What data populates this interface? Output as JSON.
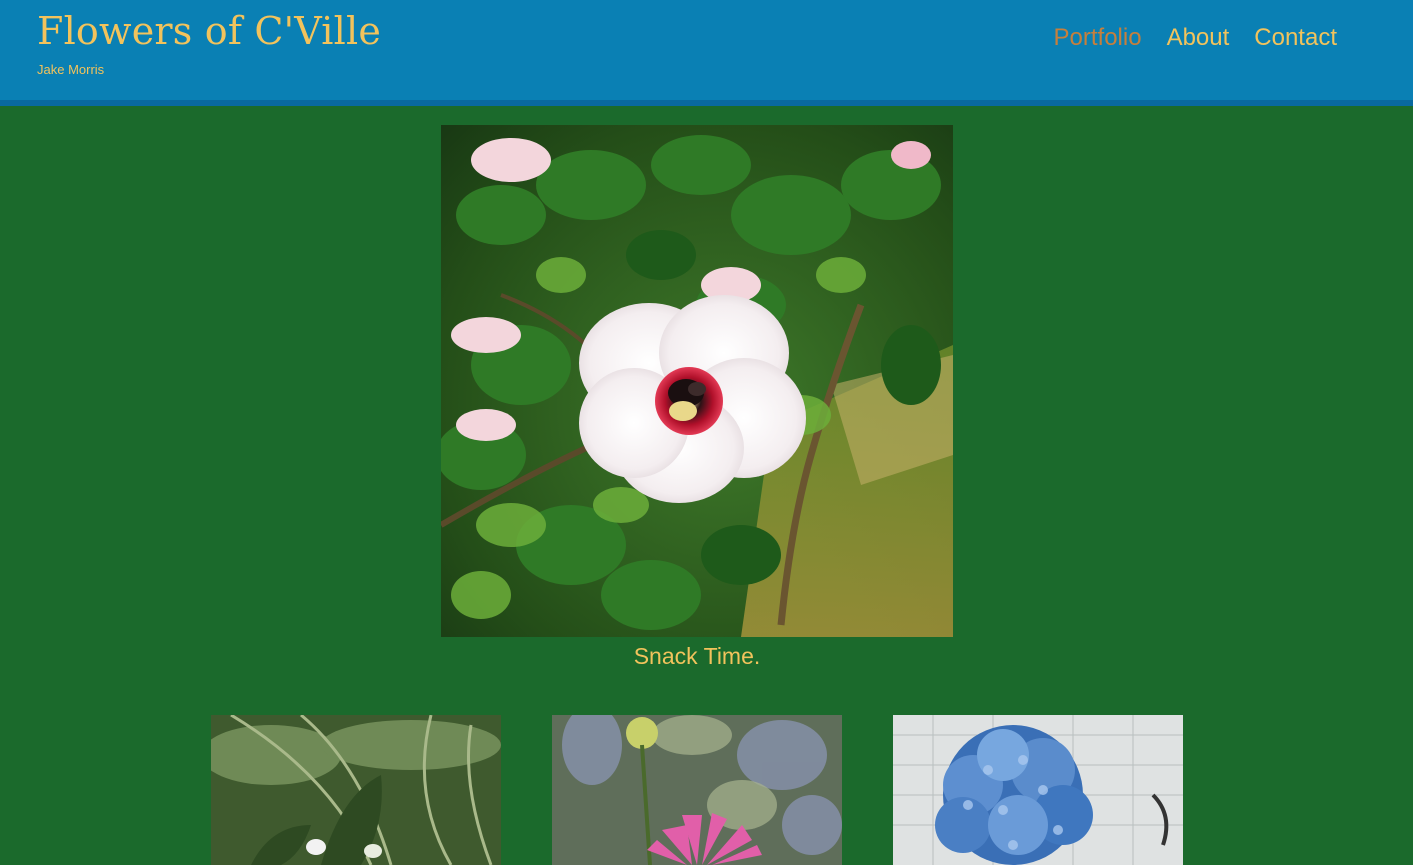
{
  "site": {
    "title": "Flowers of C'Ville",
    "subtitle": "Jake Morris"
  },
  "nav": {
    "items": [
      {
        "label": "Portfolio",
        "active": true
      },
      {
        "label": "About",
        "active": false
      },
      {
        "label": "Contact",
        "active": false
      }
    ]
  },
  "featured": {
    "caption": "Snack Time."
  },
  "colors": {
    "header_bg": "#0a80b4",
    "page_bg": "#1b6a2c",
    "title_gold": "#f2c35c",
    "active_nav": "#c67f3c"
  }
}
